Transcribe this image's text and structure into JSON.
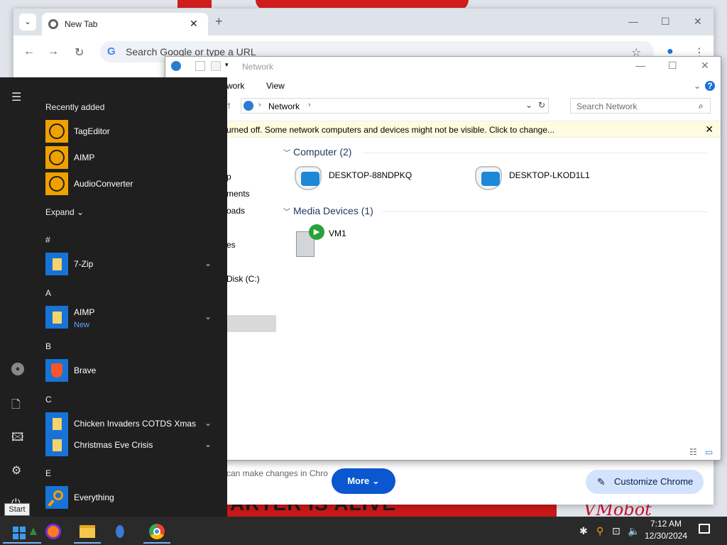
{
  "chrome": {
    "tab_title": "New Tab",
    "omnibox_placeholder": "Search Google or type a URL",
    "snippet_text": "can make changes in Chro",
    "more_button": "More",
    "customize_button": "Customize Chrome"
  },
  "explorer": {
    "title": "Network",
    "ribbon": {
      "tab_network": "work",
      "tab_view": "View"
    },
    "address_segment": "Network",
    "search_placeholder": "Search Network",
    "info_bar": "urned off. Some network computers and devices might not be visible. Click to change...",
    "nav_items": [
      "p",
      "ments",
      "oads",
      "es",
      "Disk (C:)",
      "",
      ""
    ],
    "groups": {
      "computer": "Computer (2)",
      "media": "Media Devices (1)"
    },
    "computers": [
      "DESKTOP-88NDPKQ",
      "DESKTOP-LKOD1L1"
    ],
    "media_devices": [
      "VM1"
    ]
  },
  "start_menu": {
    "recently_added": "Recently added",
    "recent_apps": [
      "TagEditor",
      "AIMP",
      "AudioConverter"
    ],
    "expand": "Expand",
    "sections": [
      {
        "letter": "#",
        "apps": [
          {
            "name": "7-Zip",
            "badge": ""
          }
        ]
      },
      {
        "letter": "A",
        "apps": [
          {
            "name": "AIMP",
            "badge": "New"
          }
        ]
      },
      {
        "letter": "B",
        "apps": [
          {
            "name": "Brave",
            "badge": ""
          }
        ]
      },
      {
        "letter": "C",
        "apps": [
          {
            "name": "Chicken Invaders COTDS Xmas",
            "badge": ""
          },
          {
            "name": "Christmas Eve Crisis",
            "badge": ""
          }
        ]
      },
      {
        "letter": "E",
        "apps": [
          {
            "name": "Everything",
            "badge": ""
          }
        ]
      }
    ]
  },
  "tooltip": "Start",
  "wallpaper": {
    "banner_text": "ARTER IS ALIVE",
    "signature": "VMobot"
  },
  "taskbar": {
    "time": "7:12 AM",
    "date": "12/30/2024"
  },
  "colors": {
    "accent": "#0b57d0",
    "start_bg": "#1f1f1f",
    "taskbar_bg": "#2a2a2a",
    "info_bar": "#fffbe0"
  }
}
